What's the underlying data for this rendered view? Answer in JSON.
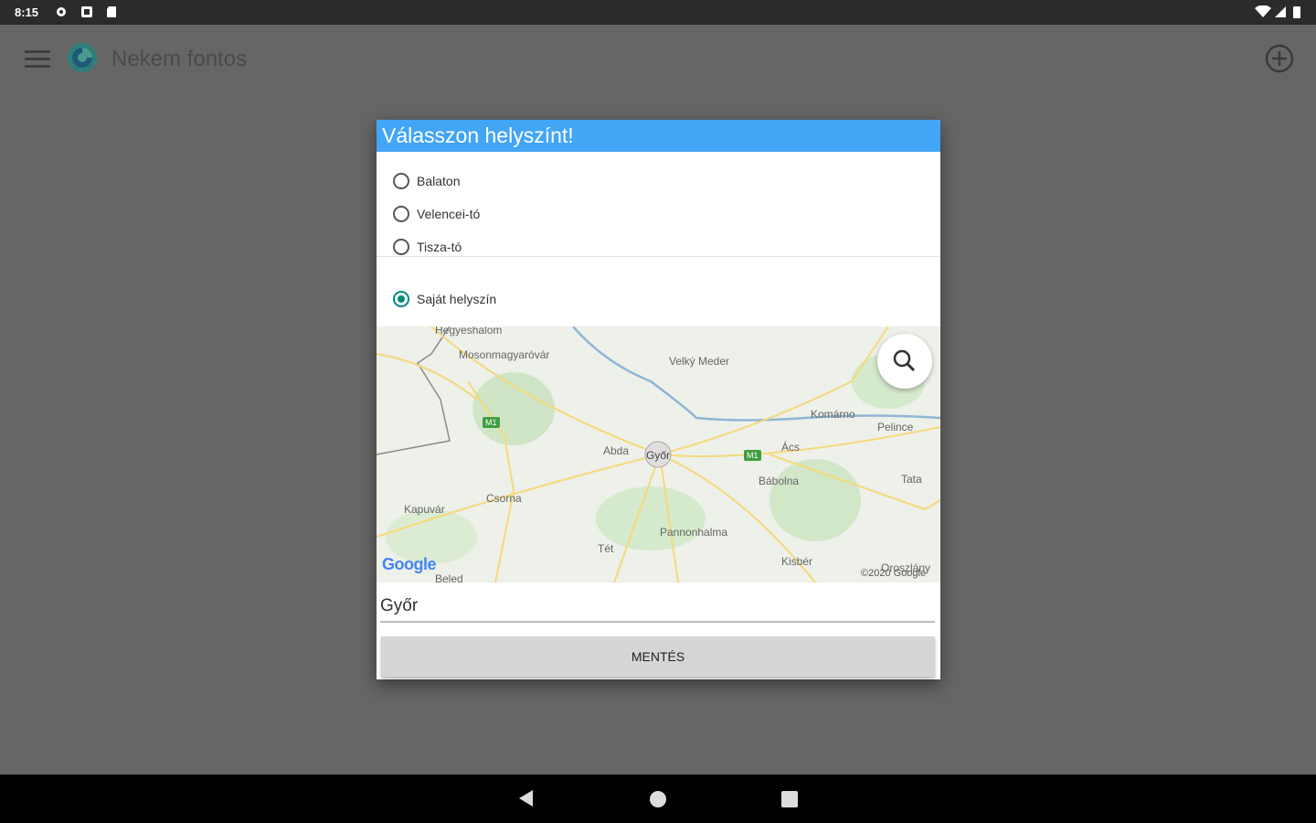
{
  "statusbar": {
    "time": "8:15"
  },
  "appbar": {
    "title": "Nekem fontos"
  },
  "dialog": {
    "title": "Válasszon helyszínt!",
    "options": [
      {
        "label": "Balaton",
        "checked": false
      },
      {
        "label": "Velencei-tó",
        "checked": false
      },
      {
        "label": "Tisza-tó",
        "checked": false
      }
    ],
    "own_location": {
      "label": "Saját helyszín",
      "checked": true
    },
    "map": {
      "labels": [
        "Hegyeshalom",
        "Mosonmagyaróvár",
        "Velký Meder",
        "Komárno",
        "Pelince",
        "Ács",
        "Abda",
        "Győr",
        "Bábolna",
        "Tata",
        "Csorna",
        "Kapuvár",
        "Pannonhalma",
        "Tét",
        "Kisbér",
        "Beled",
        "Oroszlány"
      ],
      "road_badges": [
        "M1",
        "M1"
      ],
      "google_logo": "Google",
      "copyright": "©2020 Google"
    },
    "city_value": "Győr",
    "save_label": "MENTÉS"
  }
}
